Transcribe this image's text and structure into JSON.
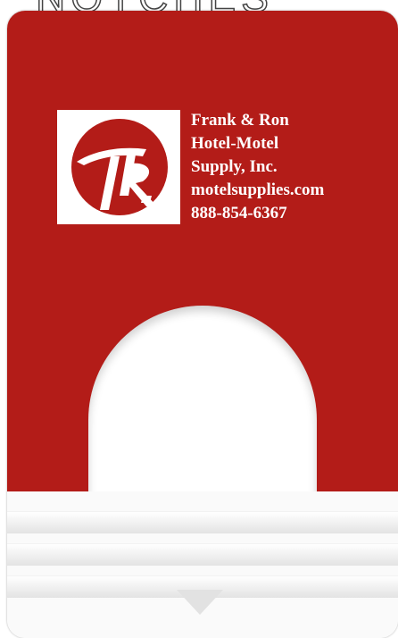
{
  "header_fragment": "NOTCHES",
  "contact": {
    "line1": "Frank & Ron",
    "line2": "Hotel-Motel",
    "line3": "Supply, Inc.",
    "website": "motelsupplies.com",
    "phone": "888-854-6367"
  },
  "logo": {
    "letters": "FR"
  },
  "colors": {
    "card_red": "#b31c18",
    "white": "#ffffff",
    "stripe_gray": "#e3e3e3"
  },
  "icons": {
    "logo": "fr-logo-icon",
    "arrow": "down-triangle-icon"
  }
}
